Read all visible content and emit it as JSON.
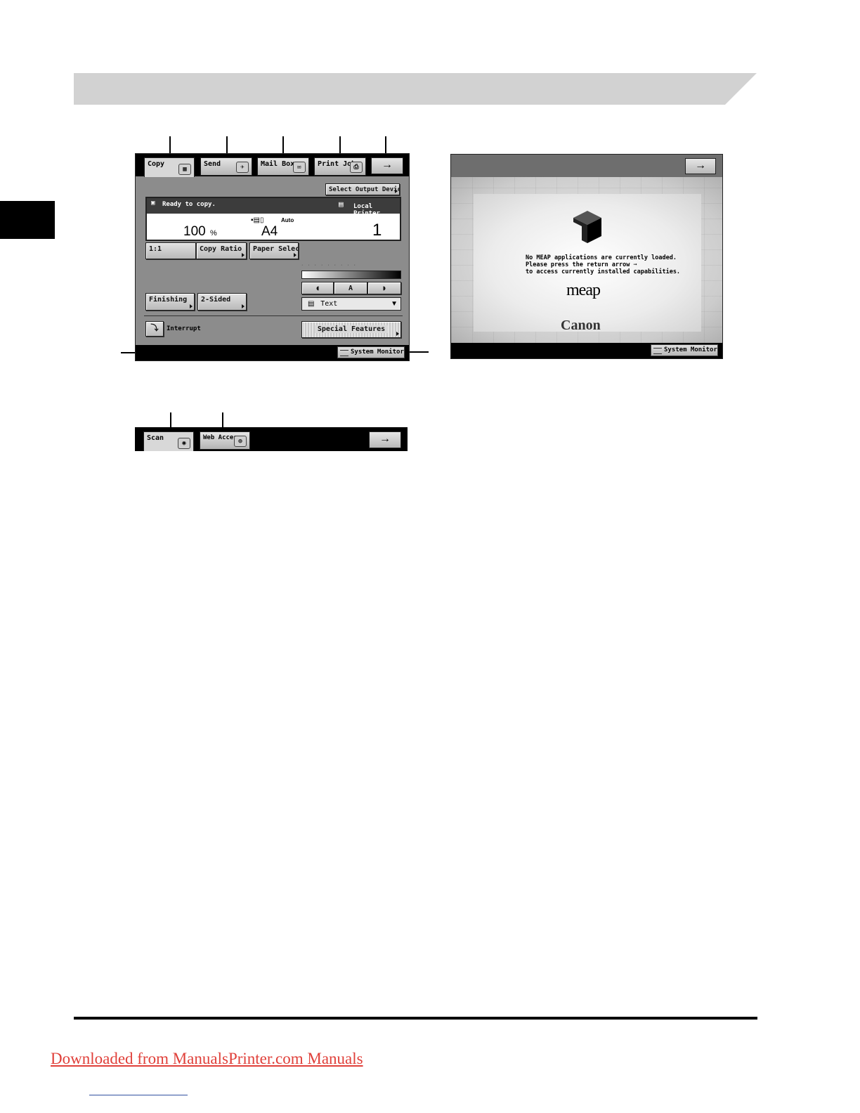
{
  "copy_screen": {
    "tabs": [
      {
        "label": "Copy"
      },
      {
        "label": "Send"
      },
      {
        "label": "Mail Box"
      },
      {
        "label": "Print Job"
      }
    ],
    "next_arrow": "→",
    "select_output_device": "Select Output Device",
    "status_text": "Ready to copy.",
    "output_device": "Local Printer",
    "ratio_value": "100",
    "ratio_unit": "%",
    "paper_mode": "Auto",
    "paper_size": "A4",
    "copy_count": "1",
    "one_to_one": "1:1",
    "copy_ratio": "Copy Ratio",
    "paper_select": "Paper Select",
    "density_light": "◖",
    "density_auto": "A",
    "density_dark": "◗",
    "finishing": "Finishing",
    "two_sided": "2-Sided",
    "image_mode": "Text",
    "interrupt": "Interrupt",
    "special_features": "Special Features",
    "system_monitor": "System Monitor"
  },
  "meap_screen": {
    "next_arrow": "→",
    "message": "No MEAP applications are currently loaded.\nPlease press the return arrow ➞\nto access currently installed capabilities.",
    "meap_logo": "meap",
    "brand_logo": "Canon",
    "system_monitor": "System Monitor"
  },
  "extra_tabs": {
    "tabs": [
      {
        "label": "Scan"
      },
      {
        "label": "Web Access"
      }
    ],
    "next_arrow": "→"
  },
  "footer": {
    "download_link": "Downloaded from ManualsPrinter.com Manuals"
  }
}
